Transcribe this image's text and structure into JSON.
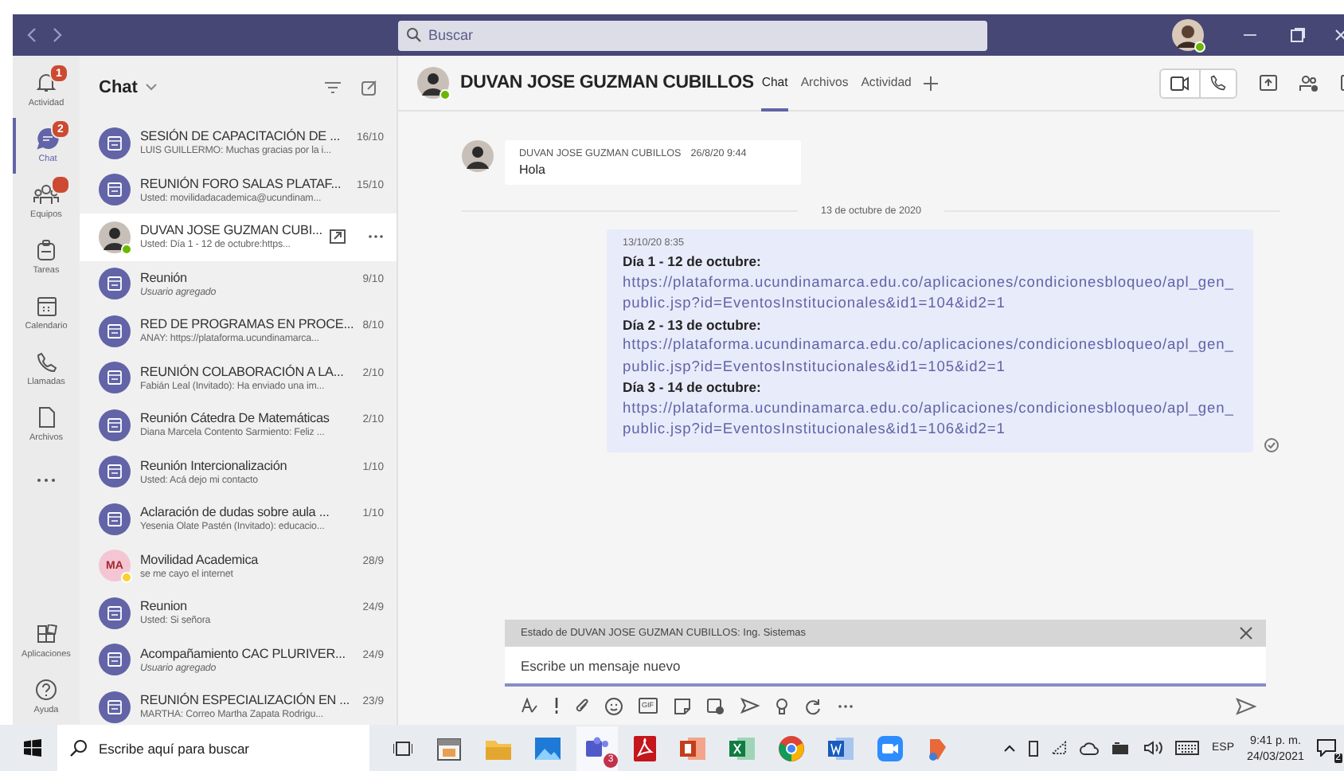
{
  "titlebar": {
    "search": {
      "placeholder": "Buscar"
    },
    "avatar": {
      "color": "#6bb700"
    }
  },
  "rail": {
    "items": [
      {
        "kind": "bell",
        "label": "Actividad",
        "badge": "1",
        "selected": false
      },
      {
        "kind": "chat",
        "label": "Chat",
        "badge": "2",
        "selected": true
      },
      {
        "kind": "teams",
        "label": "Equipos",
        "badge_dot": true,
        "selected": false
      },
      {
        "kind": "tasks",
        "label": "Tareas",
        "selected": false
      },
      {
        "kind": "calendar",
        "label": "Calendario",
        "selected": false
      },
      {
        "kind": "phone",
        "label": "Llamadas",
        "selected": false
      },
      {
        "kind": "file",
        "label": "Archivos",
        "selected": false
      },
      {
        "kind": "more",
        "selected": false
      }
    ],
    "bottom": [
      {
        "kind": "apps",
        "label": "Aplicaciones",
        "selected": false
      },
      {
        "kind": "help",
        "label": "Ayuda",
        "selected": false
      }
    ]
  },
  "chat_list": {
    "title": "Chat",
    "items": [
      {
        "avatar": {
          "kind": "meeting"
        },
        "title": "SESIÓN DE CAPACITACIÓN DE ...",
        "time": "16/10",
        "preview": "LUIS GUILLERMO: Muchas gracias por la i...",
        "italic": false,
        "selected": false
      },
      {
        "avatar": {
          "kind": "meeting"
        },
        "title": "REUNIÓN FORO SALAS PLATAF...",
        "time": "15/10",
        "preview": "Usted: movilidadacademica@ucundinam...",
        "italic": false,
        "selected": false
      },
      {
        "avatar": {
          "kind": "photo",
          "color": "#6bb700"
        },
        "title": "DUVAN JOSE GUZMAN CUBI...",
        "preview": "Usted: Día 1 - 12 de octubre:https...",
        "italic": false,
        "selected": true
      },
      {
        "avatar": {
          "kind": "meeting"
        },
        "title": "Reunión",
        "time": "9/10",
        "preview": "Usuario agregado",
        "italic": true,
        "selected": false
      },
      {
        "avatar": {
          "kind": "meeting"
        },
        "title": "RED DE PROGRAMAS EN PROCE...",
        "time": "8/10",
        "preview": "ANAY: https://plataforma.ucundinamarca...",
        "italic": false,
        "selected": false
      },
      {
        "avatar": {
          "kind": "meeting"
        },
        "title": "REUNIÓN COLABORACIÓN A LA...",
        "time": "2/10",
        "preview": "Fabián Leal (Invitado): Ha enviado una im...",
        "italic": false,
        "selected": false
      },
      {
        "avatar": {
          "kind": "meeting"
        },
        "title": "Reunión Cátedra De Matemáticas",
        "time": "2/10",
        "preview": "Diana Marcela Contento Sarmiento: Feliz ...",
        "italic": false,
        "selected": false
      },
      {
        "avatar": {
          "kind": "meeting"
        },
        "title": "Reunión Intercionalización",
        "time": "1/10",
        "preview": "Usted: Acá dejo mi contacto",
        "italic": false,
        "selected": false
      },
      {
        "avatar": {
          "kind": "meeting"
        },
        "title": "Aclaración de dudas sobre aula ...",
        "time": "1/10",
        "preview": "Yesenia Olate Pastén (Invitado): educacio...",
        "italic": false,
        "selected": false
      },
      {
        "avatar": {
          "kind": "initials",
          "initials": "MA",
          "color": "#f8d22a"
        },
        "title": "Movilidad Academica",
        "time": "28/9",
        "preview": "se me cayo el internet",
        "italic": false,
        "selected": false
      },
      {
        "avatar": {
          "kind": "meeting"
        },
        "title": "Reunion",
        "time": "24/9",
        "preview": "Usted: Si señora",
        "italic": false,
        "selected": false
      },
      {
        "avatar": {
          "kind": "meeting"
        },
        "title": "Acompañamiento CAC PLURIVER...",
        "time": "24/9",
        "preview": "Usuario agregado",
        "italic": true,
        "selected": false
      },
      {
        "avatar": {
          "kind": "meeting"
        },
        "title": "REUNIÓN ESPECIALIZACIÓN EN ...",
        "time": "23/9",
        "preview": "MARTHA: Correo Martha Zapata Rodrigu...",
        "italic": false,
        "selected": false
      }
    ]
  },
  "conversation": {
    "name": "DUVAN JOSE GUZMAN CUBILLOS",
    "avatar": {
      "color": "#6bb700"
    },
    "tabs": [
      {
        "label": "Chat",
        "selected": true
      },
      {
        "label": "Archivos",
        "selected": false
      },
      {
        "label": "Actividad",
        "selected": false
      }
    ],
    "messages": [
      {
        "kind": "received",
        "sender": "DUVAN JOSE GUZMAN CUBILLOS",
        "time": "26/8/20 9:44",
        "blocks": [
          {
            "kind": "text",
            "text": "Hola"
          }
        ]
      },
      {
        "kind": "divider",
        "text": "13 de octubre de 2020"
      },
      {
        "kind": "sent",
        "time": "13/10/20 8:35",
        "read": true,
        "blocks": [
          {
            "kind": "heading",
            "text": "Día 1 - 12 de octubre:"
          },
          {
            "kind": "link",
            "text": "https://plataforma.ucundinamarca.edu.co/aplicaciones/condicionesbloqueo/apl_gen_public.jsp?id=EventosInstitucionales&id1=104&id2=1"
          },
          {
            "kind": "heading",
            "text": "Día 2 - 13 de octubre:"
          },
          {
            "kind": "link",
            "text": "https://plataforma.ucundinamarca.edu.co/aplicaciones/condicionesbloqueo/apl_gen_public.jsp?id=EventosInstitucionales&id1=105&id2=1"
          },
          {
            "kind": "heading",
            "text": "Día 3 - 14 de octubre:"
          },
          {
            "kind": "link",
            "text": "https://plataforma.ucundinamarca.edu.co/aplicaciones/condicionesbloqueo/apl_gen_public.jsp?id=EventosInstitucionales&id1=106&id2=1"
          }
        ]
      }
    ],
    "compose": {
      "status": "Estado de DUVAN JOSE GUZMAN CUBILLOS: Ing. Sistemas",
      "placeholder": "Escribe un mensaje nuevo",
      "gif_label": "GIF"
    }
  },
  "taskbar": {
    "search": {
      "placeholder": "Escribe aquí para buscar"
    },
    "teams_badge": "3",
    "language": "ESP",
    "time": "9:41 p. m.",
    "date": "24/03/2021",
    "notification_badge": "2"
  }
}
